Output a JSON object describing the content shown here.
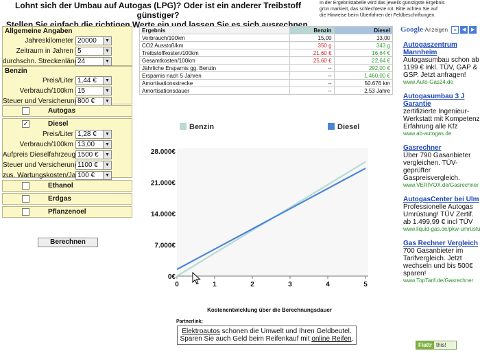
{
  "header": {
    "headline_1": "Lohnt sich der Umbau auf Autogas (LPG)? Oder ist ein anderer Treibstoff günstiger?",
    "headline_2": "Stellen Sie einfach die richtigen Werte ein und lassen Sie es sich ausrechnen.",
    "note_1": "In der Ergebnistabelle wird das jeweils günstigste Ergebnis",
    "note_2": "grün markiert, das schlechteste rot. Bitte achten Sie auf",
    "note_3": "die Hinweise beim Überfahren der Feldbeschriftungen."
  },
  "general": {
    "title": "Allgemeine Angaben",
    "fields": [
      {
        "label": "Jahreskilometer",
        "value": "20000"
      },
      {
        "label": "Zeitraum in Jahren",
        "value": "5"
      },
      {
        "label": "durchschn. Streckenlänge",
        "value": "24"
      }
    ]
  },
  "benzin": {
    "title": "Benzin",
    "fields": [
      {
        "label": "Preis/Liter",
        "value": "1,44 €"
      },
      {
        "label": "Verbrauch/100km",
        "value": "15"
      },
      {
        "label": "Steuer und Versicherung/Jahr",
        "value": "800 €"
      }
    ]
  },
  "autogas": {
    "title": "Autogas",
    "checked": false
  },
  "diesel": {
    "title": "Diesel",
    "checked": true,
    "check_glyph": "✓",
    "fields": [
      {
        "label": "Preis/Liter",
        "value": "1,28 €"
      },
      {
        "label": "Verbrauch/100km",
        "value": "13,00"
      },
      {
        "label": "Aufpreis Dieselfahrzeug",
        "value": "1500 €"
      },
      {
        "label": "Steuer und Versicherung/Jahr",
        "value": "1100 €"
      },
      {
        "label": "zus. Wartungskosten/Jahr",
        "value": "100 €"
      }
    ]
  },
  "ethanol": {
    "title": "Ethanol",
    "checked": false
  },
  "erdgas": {
    "title": "Erdgas",
    "checked": false
  },
  "pflanzenoel": {
    "title": "Pflanzenoel",
    "checked": false
  },
  "calculate_label": "Berechnen",
  "results": {
    "headers": [
      "Ergebnis",
      "Benzin",
      "Diesel"
    ],
    "rows": [
      {
        "label": "Verbrauch/100km",
        "benzin": "15,00",
        "diesel": "13,00",
        "b_cls": "",
        "d_cls": ""
      },
      {
        "label": "CO2 Ausstoß/km",
        "benzin": "350 g",
        "diesel": "343 g",
        "b_cls": "red",
        "d_cls": "green"
      },
      {
        "label": "Treibstoffkosten/100km",
        "benzin": "21,60 €",
        "diesel": "16,64 €",
        "b_cls": "red",
        "d_cls": "green"
      },
      {
        "label": "Gesamtkosten/100km",
        "benzin": "25,60 €",
        "diesel": "22,64 €",
        "b_cls": "red",
        "d_cls": "green"
      },
      {
        "label": "Jährliche Ersparnis gg. Benzin",
        "benzin": "--",
        "diesel": "292,00 €",
        "b_cls": "",
        "d_cls": "green"
      },
      {
        "label": "Ersparnis nach 5 Jahren",
        "benzin": "--",
        "diesel": "1.460,00 €",
        "b_cls": "",
        "d_cls": "green"
      },
      {
        "label": "Amortisationsstrecke",
        "benzin": "--",
        "diesel": "50.676 km",
        "b_cls": "",
        "d_cls": ""
      },
      {
        "label": "Amortisationsdauer",
        "benzin": "--",
        "diesel": "2,53 Jahre",
        "b_cls": "",
        "d_cls": ""
      }
    ]
  },
  "chart_data": {
    "type": "line",
    "title": "",
    "xlabel": "Kostenentwicklung über die Berechnungsdauer",
    "ylabel": "",
    "x": [
      0,
      1,
      2,
      3,
      4,
      5
    ],
    "xlim": [
      0,
      5
    ],
    "ylim": [
      0,
      28000
    ],
    "yticks": [
      0,
      7000,
      14000,
      21000,
      28000
    ],
    "ytick_labels": [
      "0€",
      "7.000€",
      "14.000€",
      "21.000€",
      "28.000€"
    ],
    "legend_position": "top",
    "grid": false,
    "series": [
      {
        "name": "Benzin",
        "color": "#b8d9d6",
        "values": [
          0,
          5120,
          10240,
          15360,
          20480,
          25600
        ]
      },
      {
        "name": "Diesel",
        "color": "#4a86d4",
        "values": [
          1500,
          6028,
          10556,
          15084,
          19612,
          24140
        ]
      }
    ]
  },
  "partner": {
    "label": "Partnerlink:",
    "link_1": "Elektroautos",
    "text_1": " schonen die Umwelt und Ihren Geldbeutel.",
    "text_2": "Sparen Sie auch Geld beim Reifenkauf mit ",
    "link_2": "online Reifen",
    "text_3": "."
  },
  "ads": {
    "logo": "Google",
    "label": "-Anzeigen",
    "items": [
      {
        "title": "Autogaszentrum Mannheim",
        "body": "Autogasumbau schon ab 1199 € inkl. TÜV, GAP & GSP. Jetzt anfragen!",
        "url": "www.Auto-Gas24.de"
      },
      {
        "title": "Autogasumbau 3 J Garantie",
        "body": "zertifizierte Ingenieur-Werkstatt mit Kompetenz Erfahrung alle Kfz",
        "url": "www.ab-autogas.de"
      },
      {
        "title": "Gasrechner",
        "body": "Über 790 Gasanbieter vergleichen. TÜV-geprüfter Gaspreisvergleich.",
        "url": "www.VERIVOX.de/Gasrechner"
      },
      {
        "title": "AutogasCenter bei Ulm",
        "body": "Professionelle Autogas Umrüstung! TÜV Zertif. ab 1.499,99 € incl TÜV",
        "url": "www.liquid-gas.de/pkw-umrüstung"
      },
      {
        "title": "Gas Rechner Vergleich",
        "body": "700 Gasanbieter im Tarifvergleich. Jetzt wechseln und bis 500€ sparen!",
        "url": "www.TopTarif.de/Gasrechner"
      }
    ]
  },
  "flattr": {
    "label": "Flattr",
    "thanks": "this!"
  }
}
